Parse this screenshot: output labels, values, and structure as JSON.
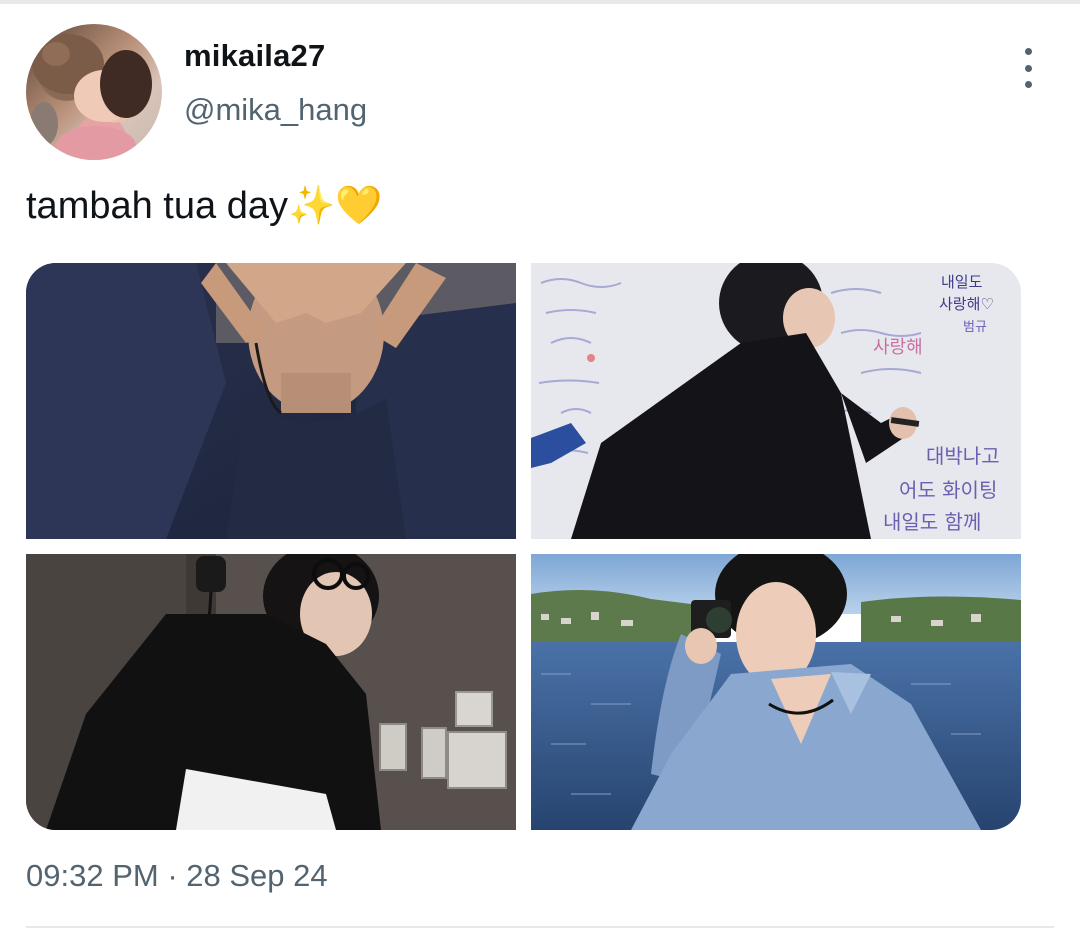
{
  "tweet": {
    "author": {
      "display_name": "mikaila27",
      "handle": "@mika_hang"
    },
    "text": "tambah tua day✨💛",
    "media_count": 4,
    "time": "09:32 PM",
    "separator": "·",
    "date": "28 Sep 24"
  },
  "icons": {
    "more": "more-vertical-icon"
  },
  "media": {
    "photo_1": {
      "wall_writing": []
    },
    "photo_2": {
      "wall_writing": [
        "내일도",
        "사랑해♡",
        "범규",
        "사랑해",
        "대박나고",
        "어도 화이팅",
        "내일도 함께"
      ]
    }
  },
  "colors": {
    "text_primary": "#0f1419",
    "text_secondary": "#536471",
    "divider": "#e6e8ea"
  }
}
